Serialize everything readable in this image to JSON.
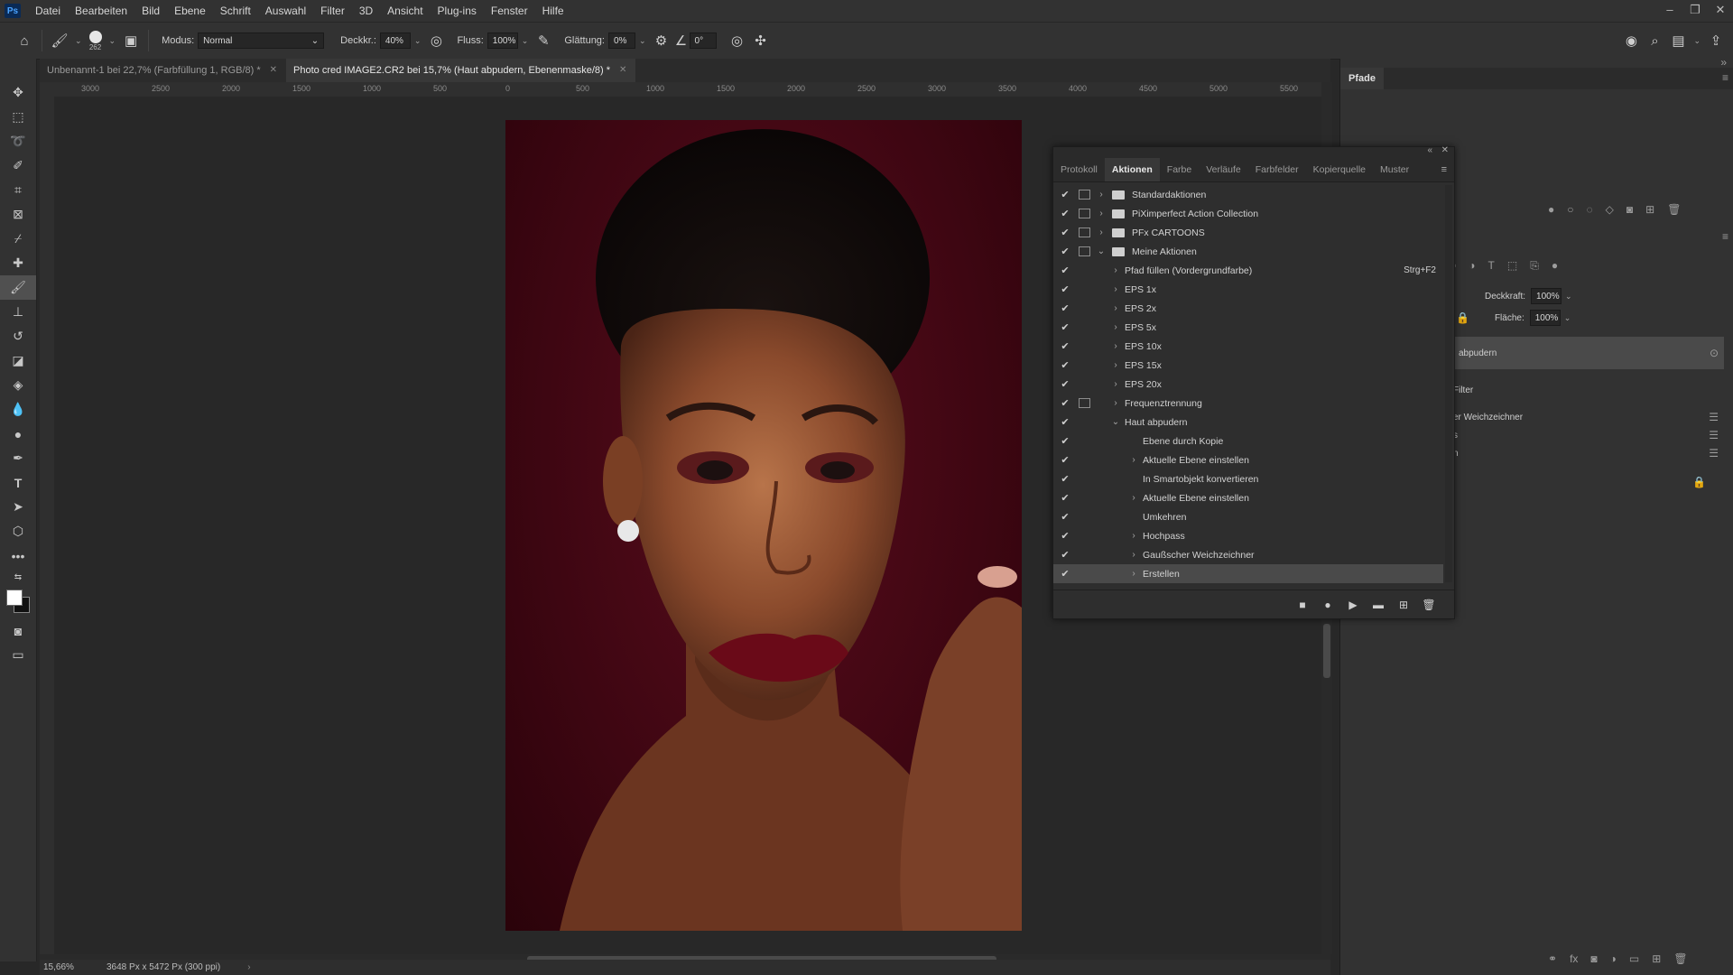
{
  "menubar": {
    "logo": "Ps",
    "items": [
      "Datei",
      "Bearbeiten",
      "Bild",
      "Ebene",
      "Schrift",
      "Auswahl",
      "Filter",
      "3D",
      "Ansicht",
      "Plug-ins",
      "Fenster",
      "Hilfe"
    ]
  },
  "options": {
    "brush_size": "262",
    "mode_label": "Modus:",
    "mode_value": "Normal",
    "opacity_label": "Deckkr.:",
    "opacity_value": "40%",
    "flow_label": "Fluss:",
    "flow_value": "100%",
    "smoothing_label": "Glättung:",
    "smoothing_value": "0%",
    "angle_value": "0°"
  },
  "tabs": [
    {
      "label": "Unbenannt-1 bei 22,7% (Farbfüllung 1, RGB/8) *"
    },
    {
      "label": "Photo cred IMAGE2.CR2 bei 15,7% (Haut abpudern, Ebenenmaske/8) *"
    }
  ],
  "ruler_top": [
    "3000",
    "2500",
    "2000",
    "1500",
    "1000",
    "500",
    "0",
    "500",
    "1000",
    "1500",
    "2000",
    "2500",
    "3000",
    "3500",
    "4000",
    "4500",
    "5000",
    "5500"
  ],
  "status": {
    "zoom": "15,66%",
    "size": "3648 Px x 5472 Px (300 ppi)"
  },
  "dock": {
    "pfade_tab": "Pfade",
    "opacity_label": "Deckkraft:",
    "opacity_value": "100%",
    "fill_label": "Fläche:",
    "fill_value": "100%",
    "layer_name": "abpudern",
    "filter_label": "Filter",
    "filter_item": "er Weichzeichner",
    "row_s": "s",
    "row_n": "n"
  },
  "actions_panel": {
    "tabs": [
      "Protokoll",
      "Aktionen",
      "Farbe",
      "Verläufe",
      "Farbfelder",
      "Kopierquelle",
      "Muster"
    ],
    "active_tab": 1,
    "rows": [
      {
        "label": "Standardaktionen",
        "level": 0,
        "folder": true,
        "dialog": true,
        "arrow": "›"
      },
      {
        "label": "PiXimperfect Action Collection",
        "level": 0,
        "folder": true,
        "dialog": true,
        "arrow": "›"
      },
      {
        "label": "PFx CARTOONS",
        "level": 0,
        "folder": true,
        "dialog": true,
        "arrow": "›"
      },
      {
        "label": "Meine Aktionen",
        "level": 0,
        "folder": true,
        "dialog": true,
        "arrow": "⌄"
      },
      {
        "label": "Pfad füllen (Vordergrundfarbe)",
        "level": 1,
        "dialog": false,
        "arrow": "›",
        "shortcut": "Strg+F2"
      },
      {
        "label": "EPS 1x",
        "level": 1,
        "dialog": false,
        "arrow": "›"
      },
      {
        "label": "EPS 2x",
        "level": 1,
        "dialog": false,
        "arrow": "›"
      },
      {
        "label": "EPS 5x",
        "level": 1,
        "dialog": false,
        "arrow": "›"
      },
      {
        "label": "EPS 10x",
        "level": 1,
        "dialog": false,
        "arrow": "›"
      },
      {
        "label": "EPS 15x",
        "level": 1,
        "dialog": false,
        "arrow": "›"
      },
      {
        "label": "EPS 20x",
        "level": 1,
        "dialog": false,
        "arrow": "›"
      },
      {
        "label": "Frequenztrennung",
        "level": 1,
        "dialog": true,
        "arrow": "›"
      },
      {
        "label": "Haut abpudern",
        "level": 1,
        "dialog": false,
        "arrow": "⌄"
      },
      {
        "label": "Ebene durch Kopie",
        "level": 2,
        "dialog": false,
        "arrow": ""
      },
      {
        "label": "Aktuelle Ebene einstellen",
        "level": 2,
        "dialog": false,
        "arrow": "›"
      },
      {
        "label": "In Smartobjekt konvertieren",
        "level": 2,
        "dialog": false,
        "arrow": ""
      },
      {
        "label": "Aktuelle Ebene einstellen",
        "level": 2,
        "dialog": false,
        "arrow": "›"
      },
      {
        "label": "Umkehren",
        "level": 2,
        "dialog": false,
        "arrow": ""
      },
      {
        "label": "Hochpass",
        "level": 2,
        "dialog": false,
        "arrow": "›"
      },
      {
        "label": "Gaußscher Weichzeichner",
        "level": 2,
        "dialog": false,
        "arrow": "›"
      },
      {
        "label": "Erstellen",
        "level": 2,
        "dialog": false,
        "arrow": "›",
        "selected": true
      }
    ]
  },
  "colors": {
    "accent": "#4aa3ff",
    "photo_bg": "#4a0816"
  }
}
